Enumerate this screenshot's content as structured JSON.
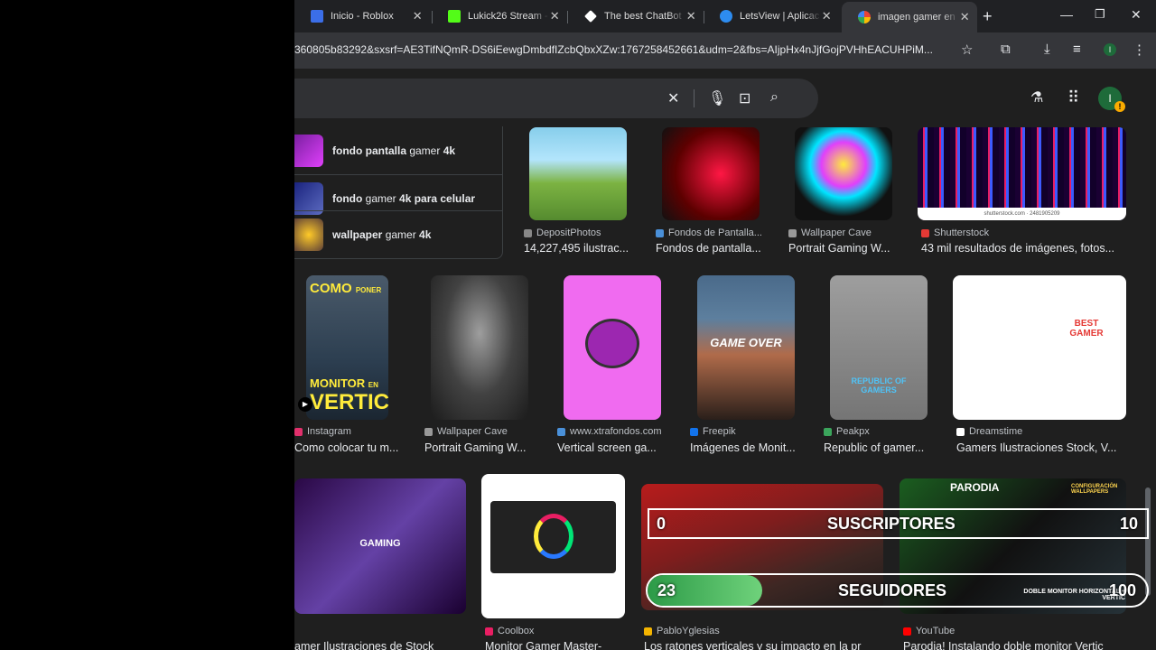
{
  "tabs": [
    {
      "title": "Inicio - Roblox",
      "icon": "roblox-icon",
      "color": "#3b6ee8"
    },
    {
      "title": "Lukick26 Stream - ",
      "icon": "kick-icon",
      "color": "#53fc18"
    },
    {
      "title": "The best ChatBot",
      "icon": "chatbot-icon",
      "color": "#ffffff"
    },
    {
      "title": "LetsView | Aplicac",
      "icon": "letsview-icon",
      "color": "#2d8cf0"
    },
    {
      "title": "imagen gamer en",
      "icon": "google-icon",
      "color": "#4285f4"
    }
  ],
  "address": {
    "url": "360805b83292&sxsrf=AE3TifNQmR-DS6iEewgDmbdfIZcbQbxXZw:1767258452661&udm=2&fbs=AIjpHx4nJjfGojPVHhEACUHPiM..."
  },
  "avatar_letter": "I",
  "suggestions": [
    {
      "bold": "fondo pantalla",
      "mid": " gamer ",
      "tail": "4k",
      "color": "#9c27b0"
    },
    {
      "bold": "fondo",
      "mid": " gamer ",
      "tail": "4k para celular",
      "color": "#3f51b5"
    },
    {
      "bold": "wallpaper",
      "mid": " gamer ",
      "tail": "4k",
      "color": "#ffb300"
    }
  ],
  "row1": [
    {
      "source": "DepositPhotos",
      "title": "14,227,495 ilustrac...",
      "si": "#888"
    },
    {
      "source": "Fondos de Pantalla...",
      "title": "Fondos de pantalla...",
      "si": "#4a90d9"
    },
    {
      "source": "Wallpaper Cave",
      "title": "Portrait Gaming W...",
      "si": "#999"
    },
    {
      "source": "Shutterstock",
      "title": "43 mil resultados de imágenes, fotos...",
      "si": "#e53935",
      "watermark": "shutterstock.com · 2481905209"
    }
  ],
  "row2": [
    {
      "source": "Instagram",
      "title": "Como colocar tu m...",
      "si": "#e1306c",
      "overlay1": "COMO",
      "overlay1b": "PONER",
      "overlay2": "MONITOR",
      "overlay2b": "EN",
      "overlay3": "VERTICAL"
    },
    {
      "source": "Wallpaper Cave",
      "title": "Portrait Gaming W...",
      "si": "#999"
    },
    {
      "source": "www.xtrafondos.com",
      "title": "Vertical screen ga...",
      "si": "#4a90d9"
    },
    {
      "source": "Freepik",
      "title": "Imágenes de Monit...",
      "si": "#1273eb",
      "overlay": "GAME OVER"
    },
    {
      "source": "Peakpx",
      "title": "Republic of gamer...",
      "si": "#3ba55c",
      "overlay": "REPUBLIC OF GAMERS"
    },
    {
      "source": "Dreamstime",
      "title": "Gamers Ilustraciones Stock, V...",
      "si": "#ffffff",
      "overlay": "BEST GAMER"
    }
  ],
  "row3": [
    {
      "source": "",
      "title": "amer Ilustraciones de Stock",
      "si": "#000",
      "overlay": "GAMING"
    },
    {
      "source": "Coolbox",
      "title": "Monitor Gamer Master-",
      "si": "#e91e63"
    },
    {
      "source": "PabloYglesias",
      "title": "Los ratones verticales y su impacto en la pr",
      "si": "#f4b400"
    },
    {
      "source": "YouTube",
      "title": "Parodia! Instalando doble monitor Vertic",
      "si": "#ff0000",
      "overlay": "PARODIA",
      "overlay2": "CONFIGURACIÓN WALLPAPERS",
      "overlay3": "DOBLE MONITOR HORIZONTAL + VERTIC"
    }
  ],
  "stream_overlay": {
    "subs_current": "0",
    "subs_label": "SUSCRIPTORES",
    "subs_goal": "10",
    "followers_current": "23",
    "followers_label": "SEGUIDORES",
    "followers_goal": "100",
    "followers_progress": 0.23
  }
}
